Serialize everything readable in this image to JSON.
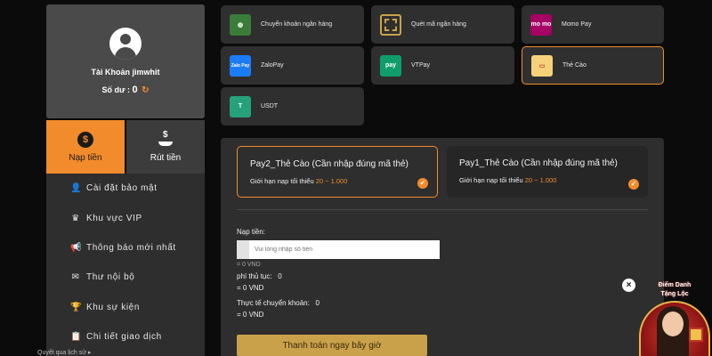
{
  "account": {
    "name": "Tài Khoản jimwhit",
    "balance_label": "Số dư :",
    "balance_value": "0"
  },
  "actions": {
    "deposit": "Nạp tiền",
    "withdraw": "Rút tiền"
  },
  "menu": [
    {
      "label": "Cài đặt bảo mật",
      "icon": "user-lock-icon"
    },
    {
      "label": "Khu vực VIP",
      "icon": "crown-icon"
    },
    {
      "label": "Thông báo mới nhất",
      "icon": "megaphone-icon"
    },
    {
      "label": "Thư nội bộ",
      "icon": "mail-icon"
    },
    {
      "label": "Khu sự kiện",
      "icon": "trophy-icon"
    },
    {
      "label": "Chi tiết giao dịch",
      "icon": "clipboard-icon"
    }
  ],
  "footer_note": "Quyết qua lịch sử ▸",
  "payment_methods": [
    {
      "label": "Chuyển khoản ngân hàng",
      "icon": "globe-icon",
      "selected": false
    },
    {
      "label": "Quét mã ngân hàng",
      "icon": "qr-icon",
      "selected": false
    },
    {
      "label": "Momo Pay",
      "icon": "momo-icon",
      "logo_text": "mo mo",
      "selected": false
    },
    {
      "label": "ZaloPay",
      "icon": "zalopay-icon",
      "logo_text": "Zalo Pay",
      "selected": false
    },
    {
      "label": "VTPay",
      "icon": "vtpay-icon",
      "logo_text": "pay",
      "selected": false
    },
    {
      "label": "Thẻ Cào",
      "icon": "scratch-card-icon",
      "selected": true
    },
    {
      "label": "USDT",
      "icon": "usdt-icon",
      "logo_text": "T",
      "selected": false
    }
  ],
  "options": [
    {
      "title": "Pay2_Thẻ Cào (Cần nhập đúng mã thẻ)",
      "limit_label": "Giới hạn nạp tối thiểu",
      "range": "20 ~ 1.000",
      "active": true
    },
    {
      "title": "Pay1_Thẻ Cào (Cần nhập đúng mã thẻ)",
      "limit_label": "Giới hạn nạp tối thiểu",
      "range": "20 ~ 1.000",
      "active": false
    }
  ],
  "form": {
    "amount_label": "Nạp tiền:",
    "amount_placeholder": "Vui lòng nhập số tiền",
    "amount_vnd": "= 0 VND",
    "fee_label": "phí thủ tục:",
    "fee_value": "0",
    "fee_vnd": "= 0 VND",
    "actual_label": "Thực tế chuyển khoản:",
    "actual_value": "0",
    "actual_vnd": "= 0 VND",
    "submit": "Thanh toán ngay bây giờ"
  },
  "promo": {
    "title_line1": "Điểm Danh",
    "title_line2": "Tặng Lộc",
    "close": "×"
  },
  "colors": {
    "accent": "#f28b2c",
    "button_gold": "#c9a14a",
    "panel": "#2e2e2e"
  }
}
